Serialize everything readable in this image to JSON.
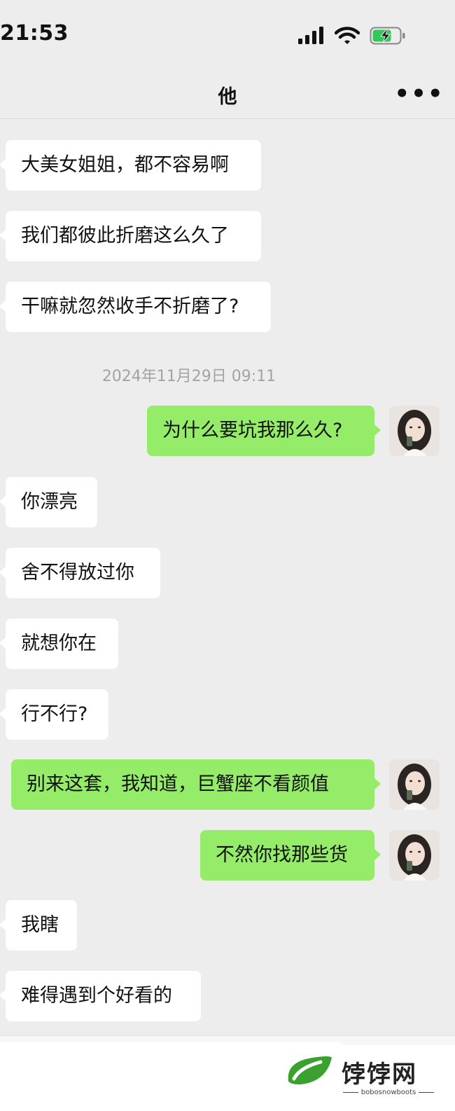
{
  "status_bar": {
    "time": "21:53"
  },
  "header": {
    "title": "他",
    "more_label": "•••"
  },
  "messages": [
    {
      "side": "in",
      "text": "大美女姐姐，都不容易啊"
    },
    {
      "side": "in",
      "text": "我们都彼此折磨这么久了"
    },
    {
      "side": "in",
      "text": "干嘛就忽然收手不折磨了?"
    },
    {
      "side": "out",
      "text": "为什么要坑我那么久?"
    },
    {
      "side": "in",
      "text": "你漂亮"
    },
    {
      "side": "in",
      "text": "舍不得放过你"
    },
    {
      "side": "in",
      "text": "就想你在"
    },
    {
      "side": "in",
      "text": "行不行?"
    },
    {
      "side": "out",
      "text": "别来这套，我知道，巨蟹座不看颜值"
    },
    {
      "side": "out",
      "text": "不然你找那些货"
    },
    {
      "side": "in",
      "text": "我瞎"
    },
    {
      "side": "in",
      "text": "难得遇到个好看的"
    }
  ],
  "timestamp": "2024年11月29日 09:11",
  "watermark": {
    "title": "饽饽网",
    "subtitle": "bobosnowboots"
  },
  "colors": {
    "background": "#ededed",
    "incoming": "#ffffff",
    "outgoing": "#95ec69",
    "timestamp": "#a3a3a3"
  }
}
